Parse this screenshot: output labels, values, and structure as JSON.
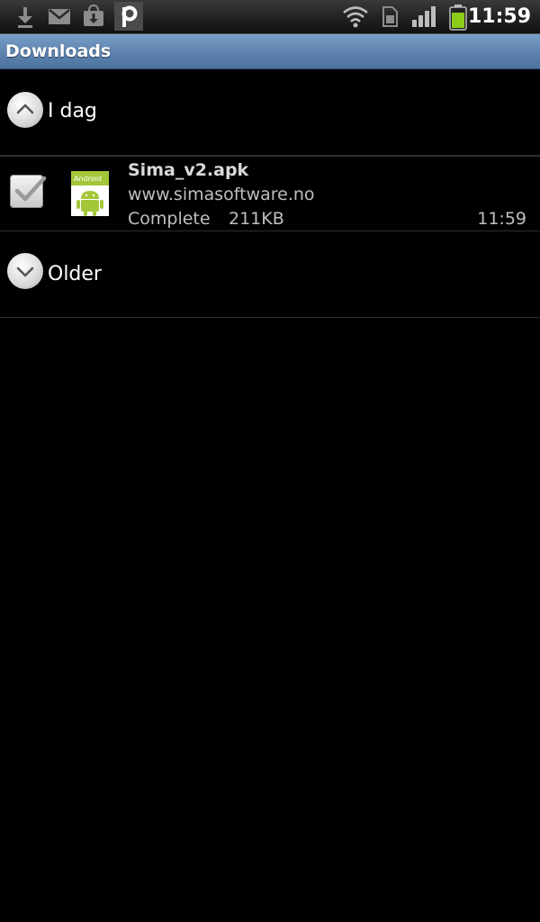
{
  "status_bar": {
    "notification_icons": [
      "download-icon",
      "gmail-icon",
      "market-download-icon",
      "pulse-app-icon"
    ],
    "system_icons": [
      "wifi-icon",
      "sim-icon",
      "signal-icon",
      "battery-icon"
    ],
    "time": "11:59"
  },
  "title_bar": {
    "title": "Downloads"
  },
  "groups": [
    {
      "label": "I dag",
      "state": "expanded",
      "icon": "chevron-up-icon"
    },
    {
      "label": "Older",
      "state": "collapsed",
      "icon": "chevron-down-icon"
    }
  ],
  "downloads": [
    {
      "checked": true,
      "icon": "android-apk-icon",
      "file_name": "Sima_v2.apk",
      "source": "www.simasoftware.no",
      "status": "Complete",
      "size": "211KB",
      "time": "11:59"
    }
  ],
  "colors": {
    "title_bar": "#5c82ad",
    "battery": "#8ccc19",
    "background": "#000000"
  }
}
